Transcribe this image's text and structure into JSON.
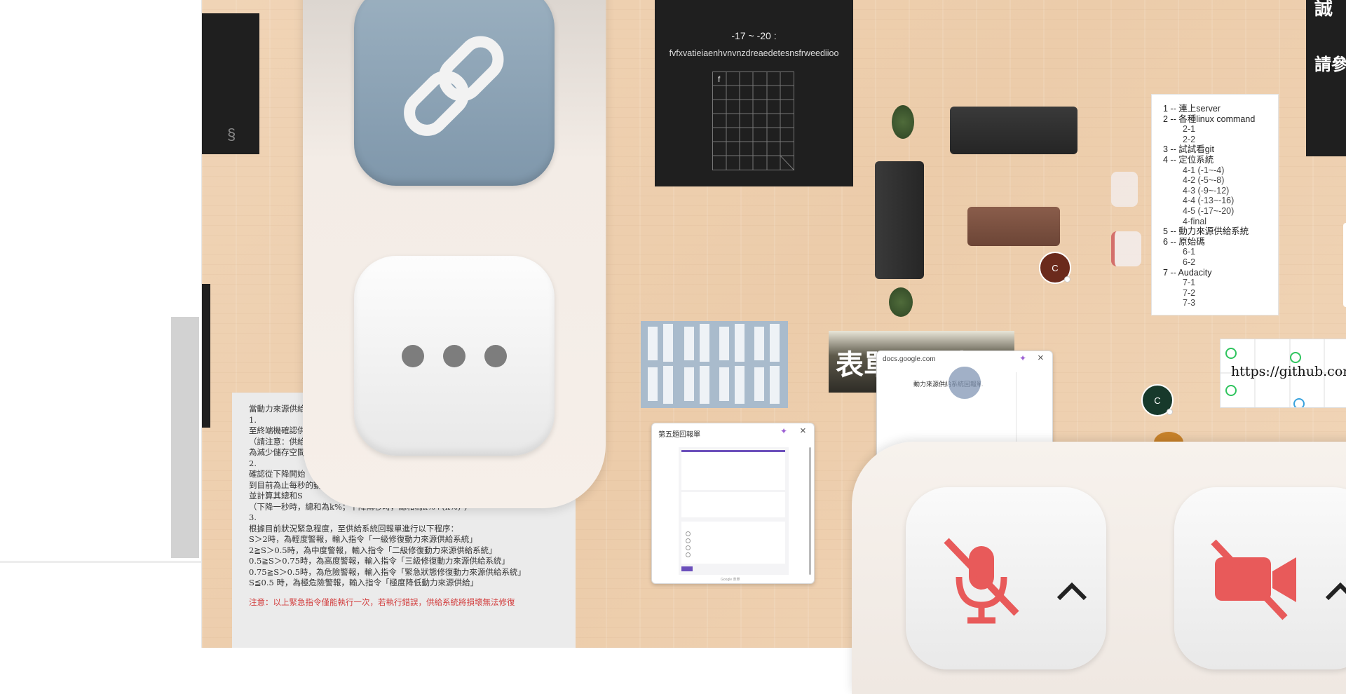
{
  "wall_panel": {
    "range_title": "-17 ~ -20 :",
    "cipher_text": "fvfxvatieiaenhvnvnzdreaedetesnsfrweediioo",
    "grid_label": "f"
  },
  "toc": {
    "items": [
      {
        "label": "1 -- 連上server",
        "sub": []
      },
      {
        "label": "2 -- 各種linux command",
        "sub": [
          "2-1",
          "2-2"
        ]
      },
      {
        "label": "3 -- 試試看git",
        "sub": []
      },
      {
        "label": "4 -- 定位系統",
        "sub": [
          "4-1 (-1~-4)",
          "4-2 (-5~-8)",
          "4-3 (-9~-12)",
          "4-4 (-13~-16)",
          "4-5 (-17~-20)",
          "4-final"
        ]
      },
      {
        "label": "5 -- 動力來源供給系統",
        "sub": []
      },
      {
        "label": "6 -- 原始碼",
        "sub": [
          "6-1",
          "6-2"
        ]
      },
      {
        "label": "7 -- Audacity",
        "sub": [
          "7-1",
          "7-2",
          "7-3"
        ]
      }
    ]
  },
  "right_banner": {
    "line1": "誠",
    "line2": "請參"
  },
  "chinese_doc": {
    "lines": [
      "當動力來源供給",
      "",
      "1.",
      "至終端機確認供",
      "（請注意：供給",
      "為減少儲存空間，",
      "",
      "2.",
      "確認從下降開始（設原本為",
      "到目前為止每秒的動力來源存量",
      "並計算其總和S",
      "（下降一秒時，總和為k%；下降兩秒時，總和為k%+(k%)²)",
      "",
      "3.",
      "根據目前狀況緊急程度，至供給系統回報單進行以下程序：",
      "S＞2時，為輕度警報，輸入指令「一級修復動力來源供給系統」",
      "2≧S＞0.5時，為中度警報，輸入指令「二級修復動力來源供給系統」",
      "0.5≧S＞0.75時，為高度警報，輸入指令「三級修復動力來源供給系統」",
      "0.75≧S＞0.5時，為危險警報，輸入指令「緊急狀態修復動力來源供給系統」",
      "S≦0.5 時，為極危險警報，輸入指令「極度降低動力來源供給」"
    ],
    "warning": "注意：以上緊急指令僅能執行一次，若執行錯誤，供給系統將損壞無法修復"
  },
  "form_popup": {
    "title": "第五題回報單",
    "footer": "Google 表單"
  },
  "docs_popup": {
    "domain": "docs.google.com",
    "form_title": "動力來源供給系統回報單"
  },
  "banner_image": {
    "text": "表單　　表單"
  },
  "github_note": {
    "text": "https://github.com/"
  },
  "avatars": [
    {
      "initial": "C",
      "color": "#6b2a1c"
    },
    {
      "initial": "C",
      "color": "#17392b"
    }
  ],
  "controls": {
    "mic_state": "muted",
    "camera_state": "off"
  }
}
